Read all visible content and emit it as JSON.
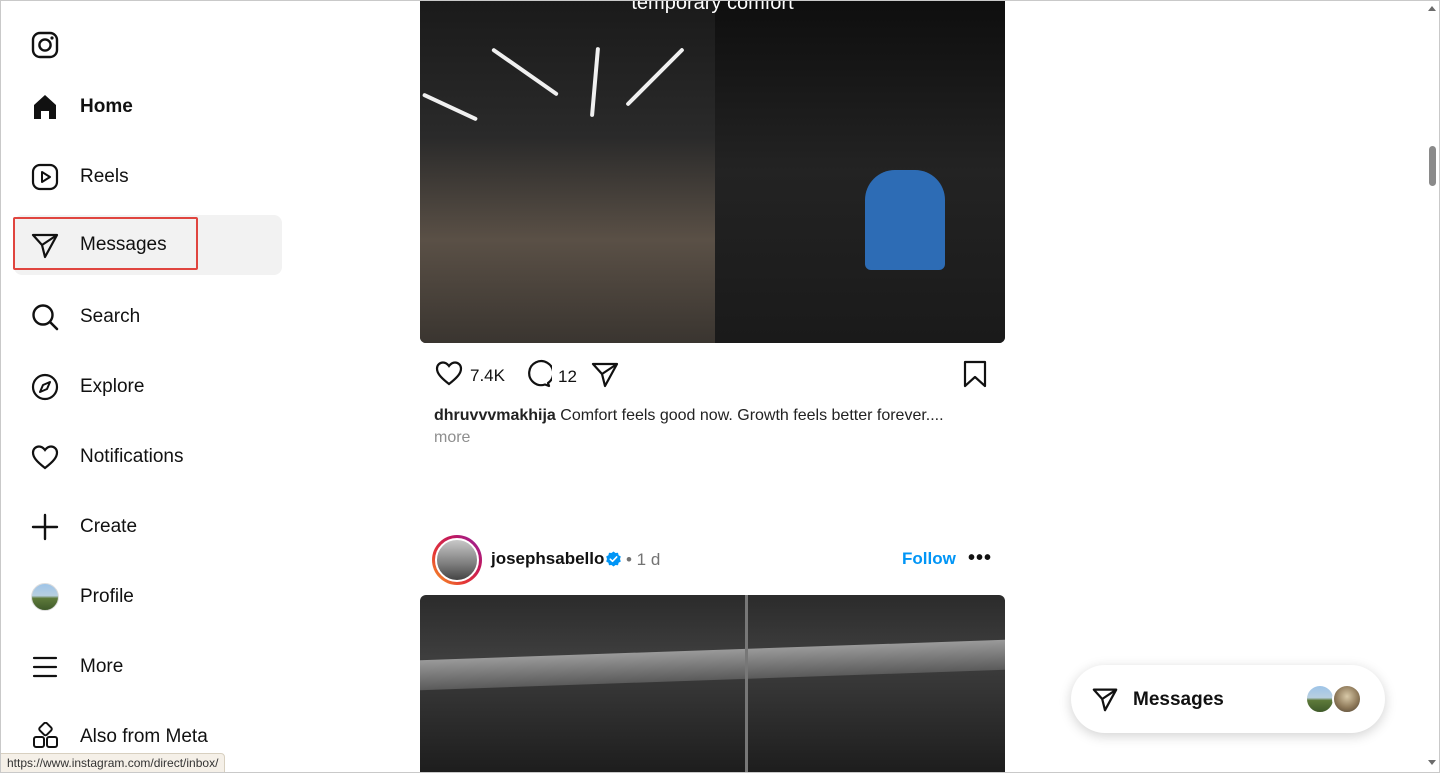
{
  "sidebar": {
    "items": [
      {
        "label": "Home",
        "icon": "home-icon"
      },
      {
        "label": "Reels",
        "icon": "reels-icon"
      },
      {
        "label": "Messages",
        "icon": "messages-icon"
      },
      {
        "label": "Search",
        "icon": "search-icon"
      },
      {
        "label": "Explore",
        "icon": "explore-icon"
      },
      {
        "label": "Notifications",
        "icon": "heart-icon"
      },
      {
        "label": "Create",
        "icon": "plus-icon"
      },
      {
        "label": "Profile",
        "icon": "avatar"
      },
      {
        "label": "More",
        "icon": "menu-icon"
      },
      {
        "label": "Also from Meta",
        "icon": "meta-apps-icon"
      }
    ],
    "active": "Messages"
  },
  "post1": {
    "overlay_text": "temporary comfort",
    "likes": "7.4K",
    "comments": "12",
    "caption_user": "dhruvvvmakhija",
    "caption_text": " Comfort feels good now. Growth feels better forever....",
    "more_label": "more"
  },
  "post2": {
    "username": "josephsabello",
    "time": "• 1 d",
    "follow_label": "Follow",
    "options_label": "•••"
  },
  "messages_dock": {
    "label": "Messages"
  },
  "status_bar": {
    "url": "https://www.instagram.com/direct/inbox/"
  },
  "colors": {
    "accent": "#0095f6",
    "highlight_border": "#e0453f",
    "active_bg": "#f2f2f2"
  }
}
